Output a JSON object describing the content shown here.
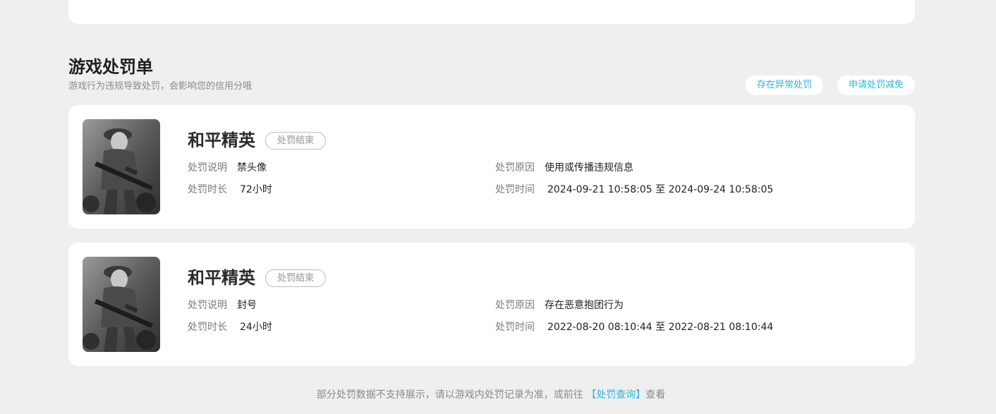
{
  "section": {
    "title": "游戏处罚单",
    "subtitle": "游戏行为违规导致处罚，会影响您的信用分哦",
    "actions": {
      "abnormal": "存在异常处罚",
      "reduce": "申请处罚减免"
    }
  },
  "records": [
    {
      "game": "和平精英",
      "status": "处罚结束",
      "desc_label": "处罚说明",
      "desc": "禁头像",
      "duration_label": "处罚时长",
      "duration": "72小时",
      "reason_label": "处罚原因",
      "reason": "使用或传播违规信息",
      "time_label": "处罚时间",
      "time": "2024-09-21 10:58:05 至 2024-09-24 10:58:05"
    },
    {
      "game": "和平精英",
      "status": "处罚结束",
      "desc_label": "处罚说明",
      "desc": "封号",
      "duration_label": "处罚时长",
      "duration": "24小时",
      "reason_label": "处罚原因",
      "reason": "存在恶意抱团行为",
      "time_label": "处罚时间",
      "time": "2022-08-20 08:10:44 至 2022-08-21 08:10:44"
    }
  ],
  "footer": {
    "prefix": "部分处罚数据不支持展示，请以游戏内处罚记录为准，或前往",
    "link": "【处罚查询】",
    "suffix": "查看"
  },
  "icons": {
    "game_thumbnail": "game-thumbnail-image"
  },
  "colors": {
    "accent": "#2fb5d8",
    "background": "#efefef",
    "card": "#ffffff"
  }
}
